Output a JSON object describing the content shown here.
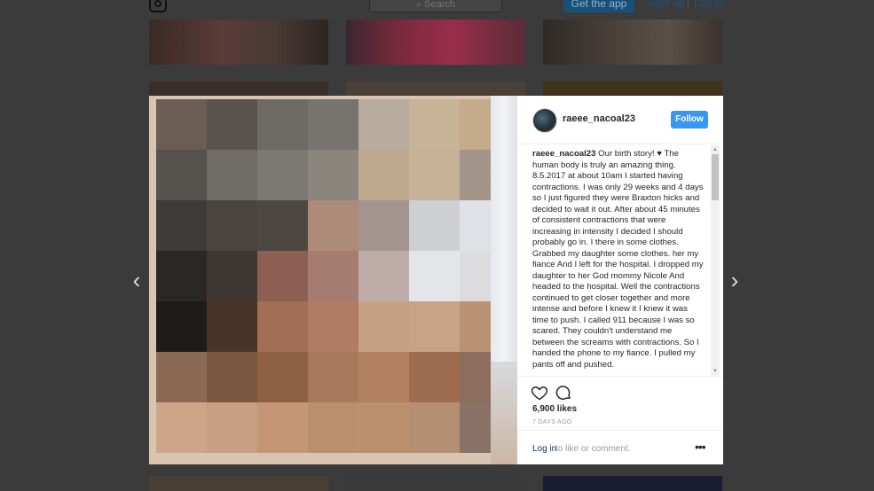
{
  "header": {
    "search_placeholder": "Search",
    "get_app": "Get the app",
    "sign_up": "Sign up",
    "separator": "|",
    "log_in": "Log in"
  },
  "post": {
    "username": "raeee_nacoal23",
    "follow_label": "Follow",
    "caption_user": "raeee_nacoal23",
    "caption_text": " Our birth story! ♥ The human body is truly an amazing thing. 8.5.2017 at about 10am I started having contractions. I was only 29 weeks and 4 days so I just figured they were Braxton hicks and decided to wait it out. After about 45 minutes of consistent contractions that were increasing in intensity I decided I should probably go in. I there in some clothes. Grabbed my daughter some clothes. her my fiance And I left for the hospital. I dropped my daughter to her God mommy Nicole And headed to the hospital. Well the contractions continued to get closer together and more intense and before I knew it I knew it was time to push. I called 911 because I was so scared. They couldn't understand me between the screams with contractions. So I handed the phone to my fiance. I pulled my pants off and pushed.",
    "likes": "6,900 likes",
    "time": "7 DAYS AGO",
    "login_link": "Log in",
    "login_rest": " to like or comment.",
    "more": "•••"
  },
  "nav": {
    "prev": "‹",
    "next": "›"
  },
  "colors": {
    "follow": "#3897f0",
    "link": "#003569",
    "overlay": "#3b3b3b"
  },
  "icons": [
    "instagram-logo-icon",
    "search-icon",
    "heart-icon",
    "comment-icon",
    "chevron-left-icon",
    "chevron-right-icon",
    "more-options-icon"
  ]
}
